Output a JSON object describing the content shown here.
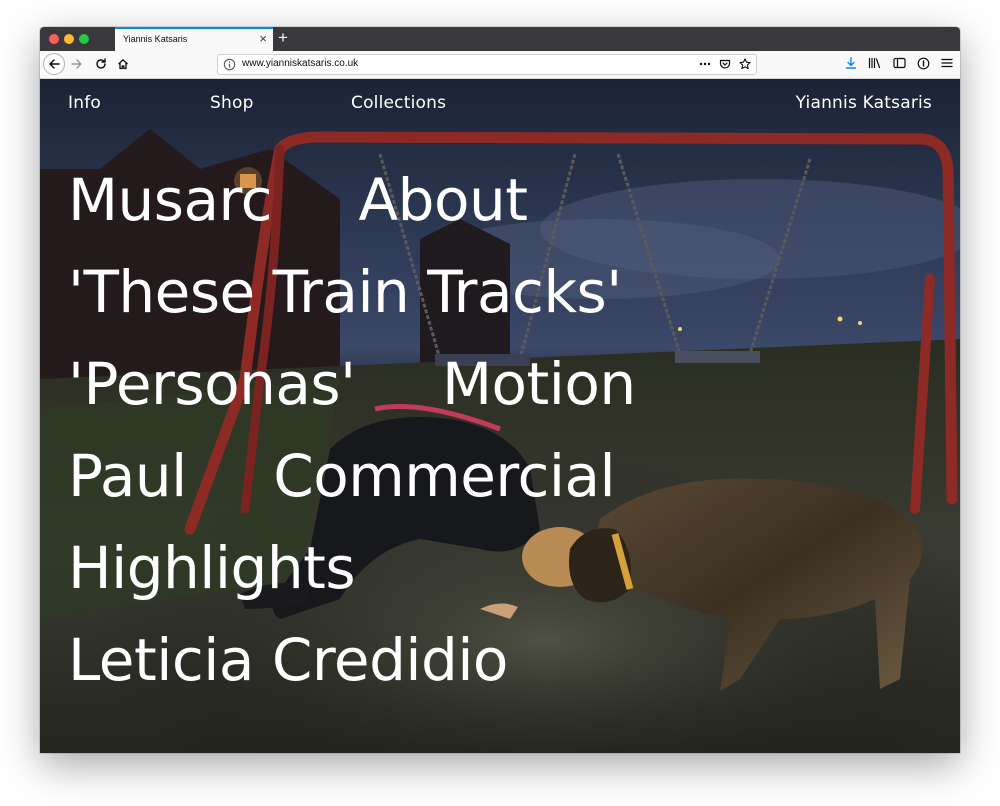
{
  "browser": {
    "tab_title": "Yiannis Katsaris",
    "tab_close": "×",
    "new_tab": "+",
    "url": "www.yianniskatsaris.co.uk",
    "icons": {
      "back": "back-arrow-icon",
      "forward": "forward-arrow-icon",
      "reload": "reload-icon",
      "home": "home-icon",
      "site_info": "info-icon",
      "page_actions": "more-dots-icon",
      "pocket": "pocket-icon",
      "bookmark": "star-icon",
      "downloads": "download-icon",
      "library": "library-icon",
      "sidebar": "sidebar-icon",
      "reader": "reader-icon",
      "menu": "hamburger-menu-icon"
    },
    "colors": {
      "tabbar": "#38383d",
      "tab_accent": "#0a84ff",
      "download_accent": "#0a84ff"
    }
  },
  "site": {
    "nav": {
      "info": "Info",
      "shop": "Shop",
      "collections": "Collections",
      "brand": "Yiannis Katsaris"
    },
    "projects": [
      [
        "Musarc",
        "About"
      ],
      [
        "'These Train Tracks'"
      ],
      [
        "'Personas'",
        "Motion"
      ],
      [
        "Paul",
        "Commercial"
      ],
      [
        "Highlights"
      ],
      [
        "Leticia Credidio"
      ]
    ]
  }
}
